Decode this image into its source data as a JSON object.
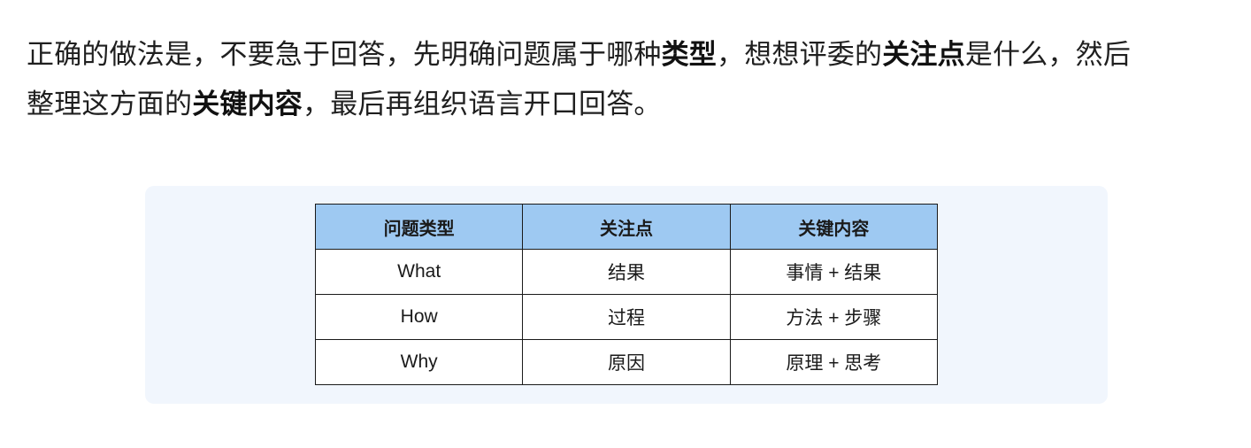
{
  "intro": {
    "line1": {
      "a": "正确的做法是，不要急于回答，先明确问题属于哪种",
      "b": "类型",
      "c": "，想想评委的",
      "d": "关注点",
      "e": "是什么，然后"
    },
    "line2": {
      "a": "整理这方面的",
      "b": "关键内容",
      "c": "，最后再组织语言开口回答。"
    }
  },
  "table": {
    "headers": [
      "问题类型",
      "关注点",
      "关键内容"
    ],
    "rows": [
      [
        "What",
        "结果",
        "事情 + 结果"
      ],
      [
        "How",
        "过程",
        "方法 + 步骤"
      ],
      [
        "Why",
        "原因",
        "原理 + 思考"
      ]
    ]
  },
  "colors": {
    "header_bg": "#9ec9f2",
    "card_bg": "#f1f6fd"
  }
}
